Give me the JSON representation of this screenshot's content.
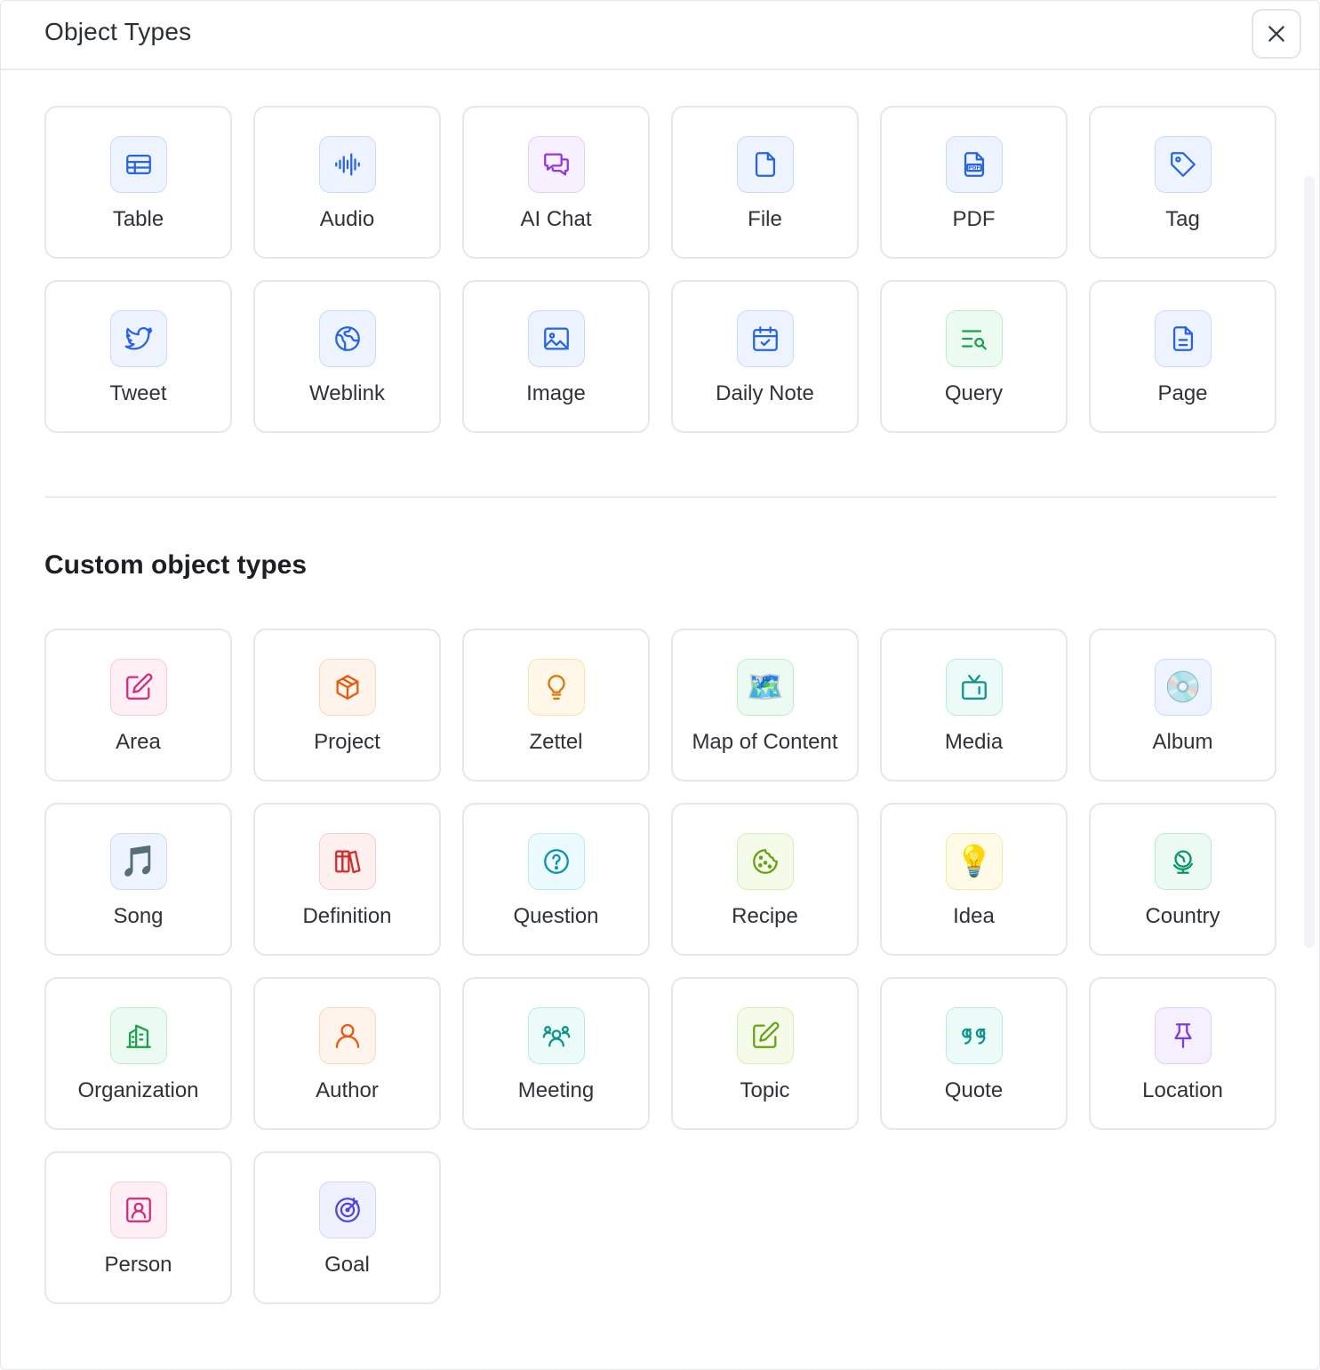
{
  "header": {
    "title": "Object Types"
  },
  "builtin": [
    {
      "label": "Table",
      "icon": "table-icon",
      "color": "#2563eb",
      "bg": "#eef4ff",
      "border": "#c9dafc"
    },
    {
      "label": "Audio",
      "icon": "audio-waveform-icon",
      "color": "#2563eb",
      "bg": "#eef4ff",
      "border": "#c9dafc"
    },
    {
      "label": "AI Chat",
      "icon": "chat-icon",
      "color": "#9333ea",
      "bg": "#f7f0ff",
      "border": "#e3cffd"
    },
    {
      "label": "File",
      "icon": "file-icon",
      "color": "#2563eb",
      "bg": "#eef4ff",
      "border": "#c9dafc"
    },
    {
      "label": "PDF",
      "icon": "pdf-icon",
      "color": "#2563eb",
      "bg": "#eef4ff",
      "border": "#c9dafc"
    },
    {
      "label": "Tag",
      "icon": "tag-icon",
      "color": "#2563eb",
      "bg": "#eef4ff",
      "border": "#c9dafc"
    },
    {
      "label": "Tweet",
      "icon": "twitter-bird-icon",
      "color": "#2563eb",
      "bg": "#eef4ff",
      "border": "#c9dafc"
    },
    {
      "label": "Weblink",
      "icon": "globe-icon",
      "color": "#2563eb",
      "bg": "#eef4ff",
      "border": "#c9dafc"
    },
    {
      "label": "Image",
      "icon": "image-icon",
      "color": "#2563eb",
      "bg": "#eef4ff",
      "border": "#c9dafc"
    },
    {
      "label": "Daily Note",
      "icon": "calendar-check-icon",
      "color": "#2563eb",
      "bg": "#eef4ff",
      "border": "#c9dafc"
    },
    {
      "label": "Query",
      "icon": "search-list-icon",
      "color": "#16a34a",
      "bg": "#ecfbf1",
      "border": "#bfeccd"
    },
    {
      "label": "Page",
      "icon": "page-icon",
      "color": "#2563eb",
      "bg": "#eef4ff",
      "border": "#c9dafc"
    }
  ],
  "section": {
    "title": "Custom object types"
  },
  "custom": [
    {
      "label": "Area",
      "icon": "edit-square-icon",
      "color": "#db2777",
      "bg": "#fff0f6",
      "border": "#f8c9dd"
    },
    {
      "label": "Project",
      "icon": "package-icon",
      "color": "#ea580c",
      "bg": "#fff4ec",
      "border": "#fcd6bd"
    },
    {
      "label": "Zettel",
      "icon": "lightbulb-outline-icon",
      "color": "#d97706",
      "bg": "#fff8e8",
      "border": "#fbe3a6"
    },
    {
      "label": "Map of Content",
      "icon": "map-emoji-icon",
      "color": "#16a34a",
      "bg": "#ecfbf1",
      "border": "#bfeccd",
      "emoji": "🗺️"
    },
    {
      "label": "Media",
      "icon": "tv-icon",
      "color": "#0d9488",
      "bg": "#ebfbf8",
      "border": "#b7ece3"
    },
    {
      "label": "Album",
      "icon": "cd-emoji-icon",
      "color": "#2563eb",
      "bg": "#eef4ff",
      "border": "#c9dafc",
      "emoji": "💿"
    },
    {
      "label": "Song",
      "icon": "music-note-emoji-icon",
      "color": "#2563eb",
      "bg": "#eef4ff",
      "border": "#c9dafc",
      "emoji": "🎵"
    },
    {
      "label": "Definition",
      "icon": "books-icon",
      "color": "#dc2626",
      "bg": "#fff0f0",
      "border": "#f8c9c9"
    },
    {
      "label": "Question",
      "icon": "question-circle-icon",
      "color": "#0891b2",
      "bg": "#ebfbfe",
      "border": "#b6ecf5"
    },
    {
      "label": "Recipe",
      "icon": "cookie-icon",
      "color": "#65a30d",
      "bg": "#f4fbe8",
      "border": "#d6eeb4"
    },
    {
      "label": "Idea",
      "icon": "lightbulb-emoji-icon",
      "color": "#ca8a04",
      "bg": "#fffbe6",
      "border": "#f8e8a6",
      "emoji": "💡"
    },
    {
      "label": "Country",
      "icon": "globe-stand-icon",
      "color": "#059669",
      "bg": "#ebfbf3",
      "border": "#b7ecd3"
    },
    {
      "label": "Organization",
      "icon": "building-icon",
      "color": "#16a34a",
      "bg": "#ecfbf1",
      "border": "#bfeccd"
    },
    {
      "label": "Author",
      "icon": "user-icon",
      "color": "#ea580c",
      "bg": "#fff4ec",
      "border": "#fcd6bd"
    },
    {
      "label": "Meeting",
      "icon": "users-group-icon",
      "color": "#0d9488",
      "bg": "#ebfbf8",
      "border": "#b7ece3"
    },
    {
      "label": "Topic",
      "icon": "edit-square-icon",
      "color": "#65a30d",
      "bg": "#f4fbe8",
      "border": "#d6eeb4"
    },
    {
      "label": "Quote",
      "icon": "quote-icon",
      "color": "#0d9488",
      "bg": "#ebfbf8",
      "border": "#b7ece3"
    },
    {
      "label": "Location",
      "icon": "pin-icon",
      "color": "#7c3aed",
      "bg": "#f5f0ff",
      "border": "#ddd0fb"
    },
    {
      "label": "Person",
      "icon": "contact-icon",
      "color": "#db2777",
      "bg": "#fff0f6",
      "border": "#f8c9dd"
    },
    {
      "label": "Goal",
      "icon": "target-icon",
      "color": "#4f46e5",
      "bg": "#f0f1ff",
      "border": "#d2d4fb"
    }
  ]
}
